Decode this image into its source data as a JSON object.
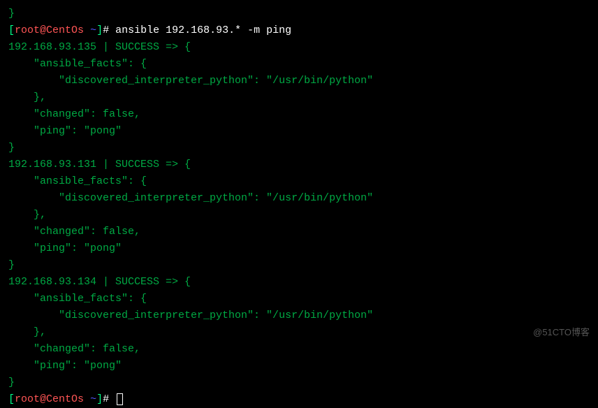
{
  "prompt1": {
    "open_bracket": "[",
    "user": "root",
    "at": "@",
    "host": "CentOs",
    "space": " ",
    "tilde": "~",
    "close_bracket": "]",
    "hash": "# "
  },
  "command": "ansible 192.168.93.* -m ping",
  "hosts": [
    {
      "header": "192.168.93.135 | SUCCESS => {",
      "facts_open": "    \"ansible_facts\": {",
      "interp": "        \"discovered_interpreter_python\": \"/usr/bin/python\"",
      "facts_close": "    },",
      "changed": "    \"changed\": false,",
      "ping": "    \"ping\": \"pong\"",
      "close": "}"
    },
    {
      "header": "192.168.93.131 | SUCCESS => {",
      "facts_open": "    \"ansible_facts\": {",
      "interp": "        \"discovered_interpreter_python\": \"/usr/bin/python\"",
      "facts_close": "    },",
      "changed": "    \"changed\": false,",
      "ping": "    \"ping\": \"pong\"",
      "close": "}"
    },
    {
      "header": "192.168.93.134 | SUCCESS => {",
      "facts_open": "    \"ansible_facts\": {",
      "interp": "        \"discovered_interpreter_python\": \"/usr/bin/python\"",
      "facts_close": "    },",
      "changed": "    \"changed\": false,",
      "ping": "    \"ping\": \"pong\"",
      "close": "}"
    }
  ],
  "pre_brace": "}",
  "watermark": "@51CTO博客"
}
